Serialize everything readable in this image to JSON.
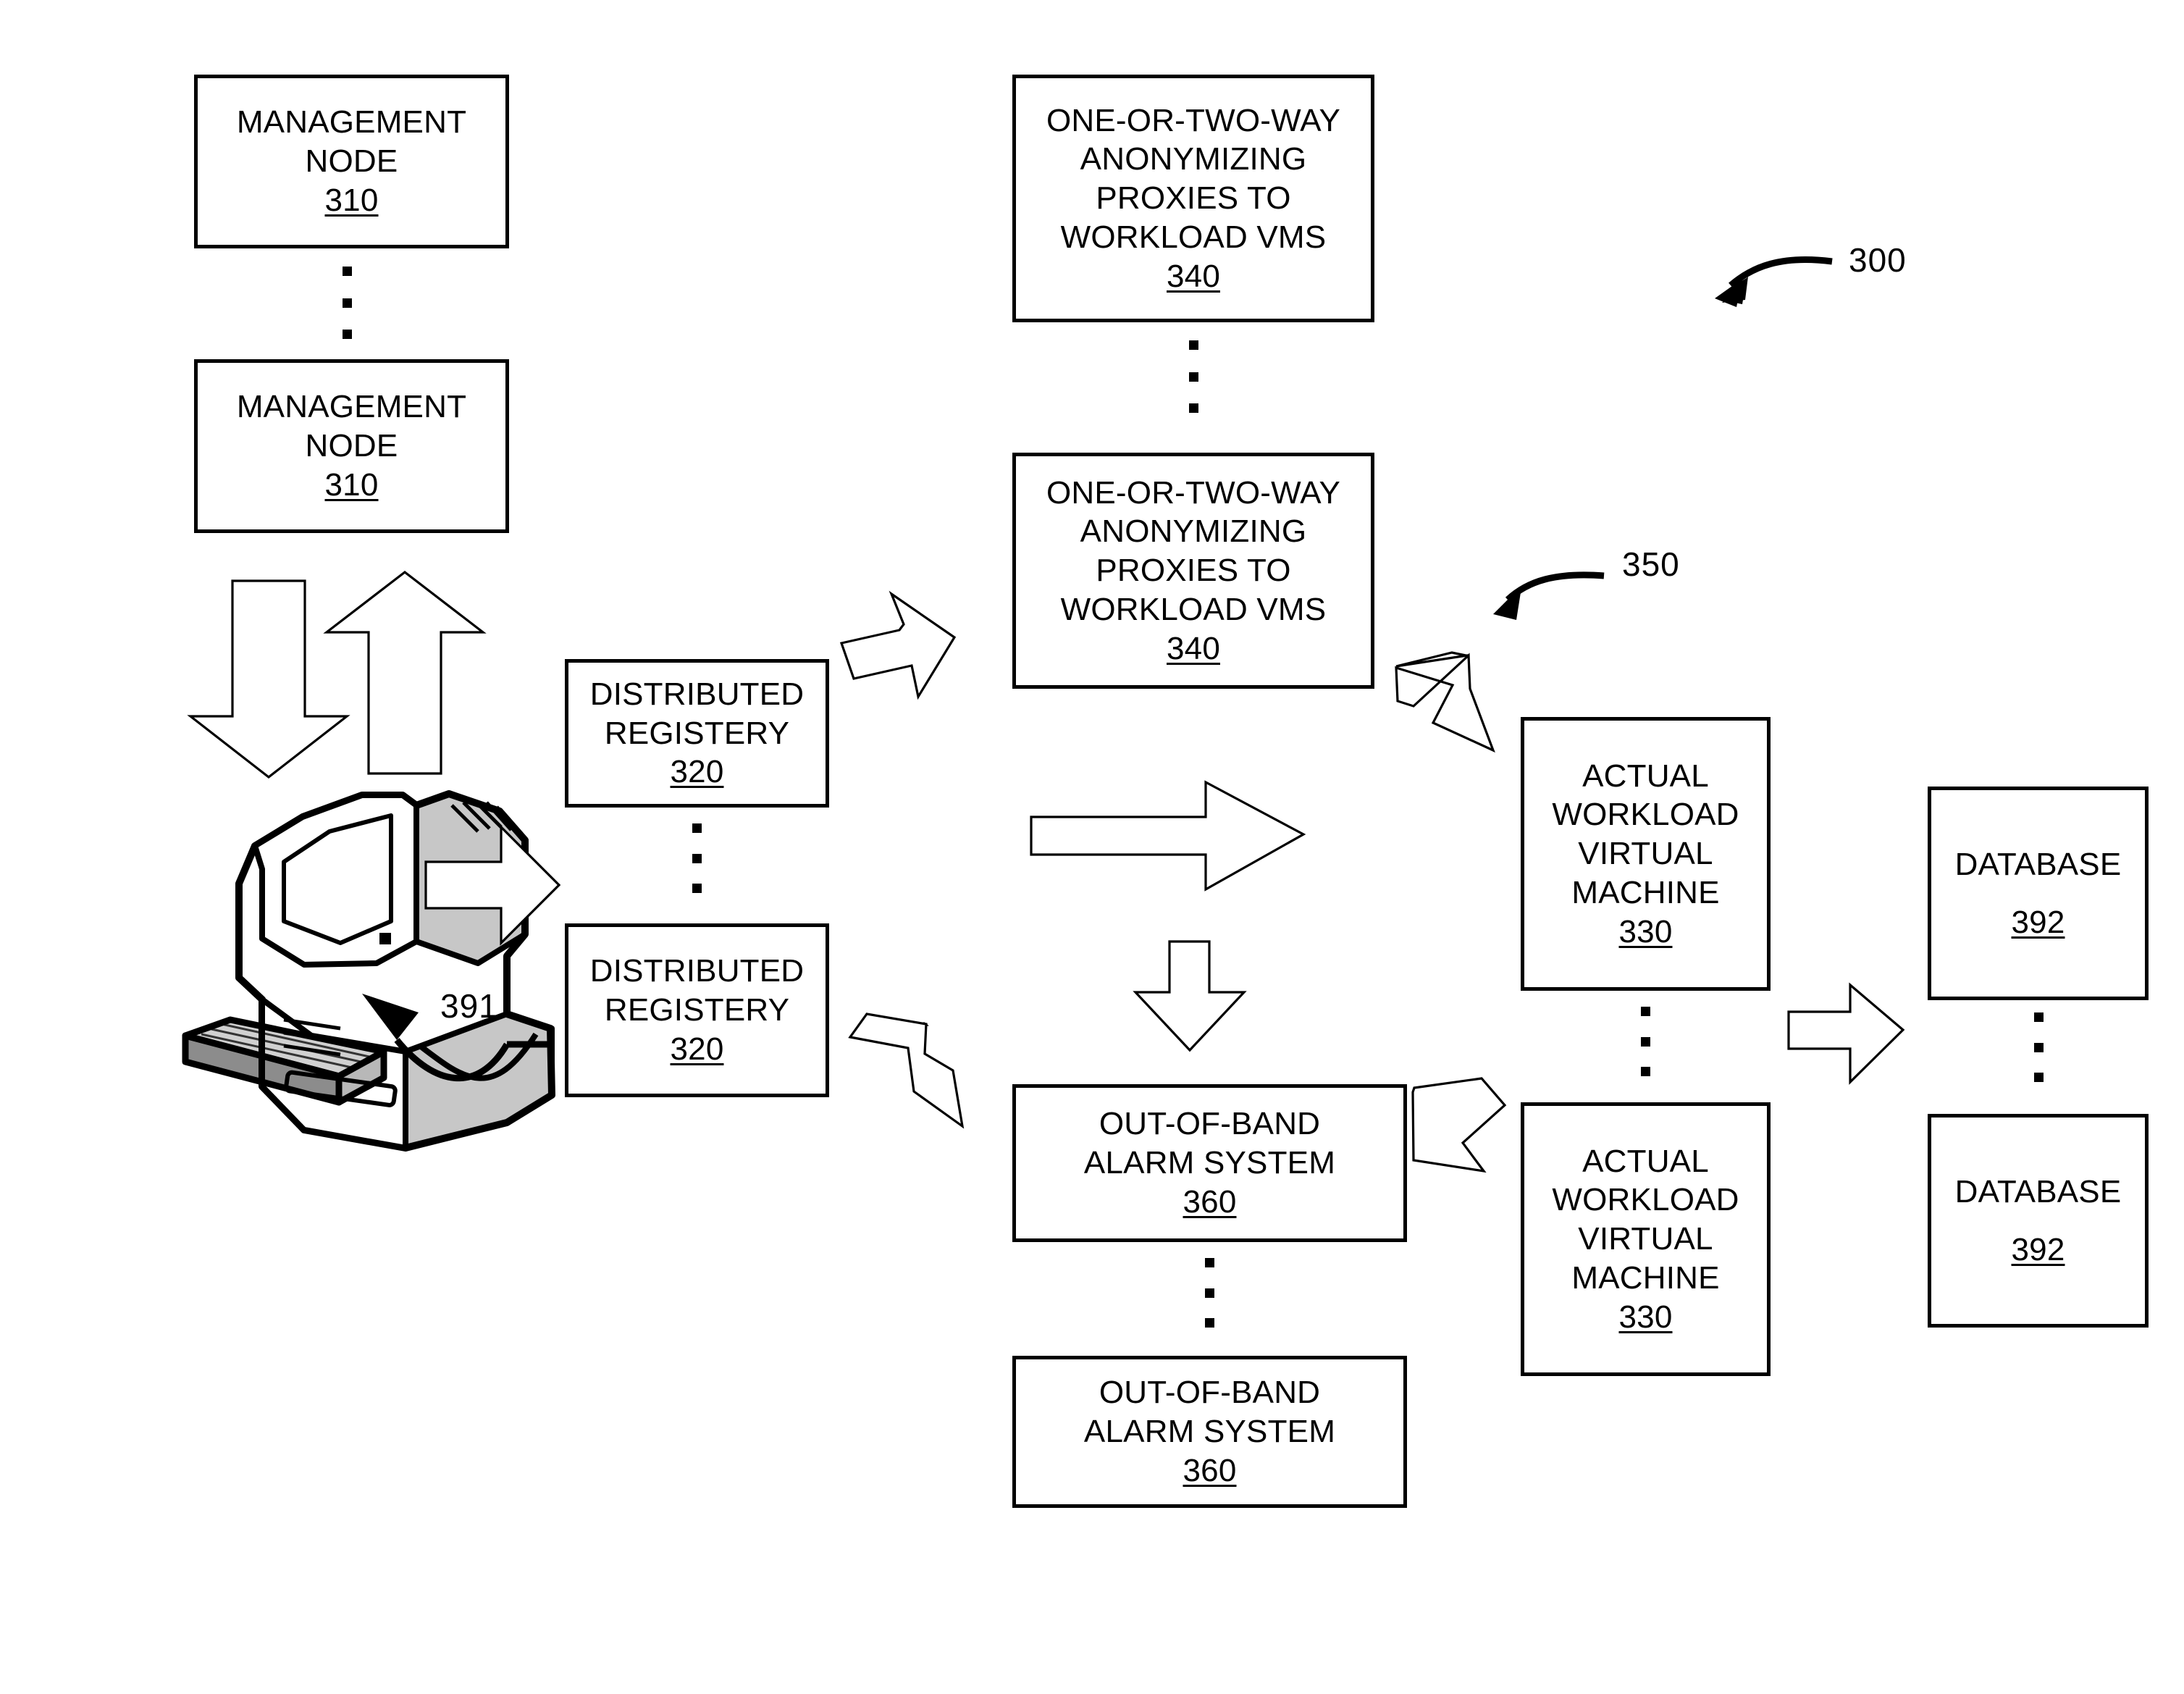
{
  "figure": {
    "id": "300",
    "callouts": [
      {
        "name": "figure-ref-300",
        "label": "300"
      },
      {
        "name": "group-ref-350",
        "label": "350"
      },
      {
        "name": "console-ref-391",
        "label": "391"
      }
    ]
  },
  "nodes": {
    "management_node_top": {
      "lines": [
        "MANAGEMENT",
        "NODE"
      ],
      "ref": "310"
    },
    "management_node_bottom": {
      "lines": [
        "MANAGEMENT",
        "NODE"
      ],
      "ref": "310"
    },
    "proxy_top": {
      "lines": [
        "ONE-OR-TWO-WAY",
        "ANONYMIZING",
        "PROXIES TO",
        "WORKLOAD VMS"
      ],
      "ref": "340"
    },
    "proxy_bottom": {
      "lines": [
        "ONE-OR-TWO-WAY",
        "ANONYMIZING",
        "PROXIES TO",
        "WORKLOAD VMS"
      ],
      "ref": "340"
    },
    "registry_top": {
      "lines": [
        "DISTRIBUTED",
        "REGISTERY"
      ],
      "ref": "320"
    },
    "registry_bottom": {
      "lines": [
        "DISTRIBUTED",
        "REGISTERY"
      ],
      "ref": "320"
    },
    "workload_vm_top": {
      "lines": [
        "ACTUAL",
        "WORKLOAD",
        "VIRTUAL",
        "MACHINE"
      ],
      "ref": "330"
    },
    "workload_vm_bottom": {
      "lines": [
        "ACTUAL",
        "WORKLOAD",
        "VIRTUAL",
        "MACHINE"
      ],
      "ref": "330"
    },
    "alarm_top": {
      "lines": [
        "OUT-OF-BAND",
        "ALARM SYSTEM"
      ],
      "ref": "360"
    },
    "alarm_bottom": {
      "lines": [
        "OUT-OF-BAND",
        "ALARM SYSTEM"
      ],
      "ref": "360"
    },
    "database_top": {
      "lines": [
        "DATABASE"
      ],
      "ref": "392"
    },
    "database_bottom": {
      "lines": [
        "DATABASE"
      ],
      "ref": "392"
    }
  },
  "icons": {
    "console": "desktop-computer-icon",
    "ellipsis": "vertical-ellipsis-icon",
    "arrow_down": "block-arrow-down-icon",
    "arrow_up": "block-arrow-up-icon",
    "arrow_right": "block-arrow-right-icon",
    "arrow_down_right": "block-arrow-down-right-icon",
    "arrow_down_left": "block-arrow-down-left-icon",
    "leader_curve": "curved-leader-arrow-icon"
  },
  "colors": {
    "ink": "#000000",
    "paper": "#ffffff"
  }
}
